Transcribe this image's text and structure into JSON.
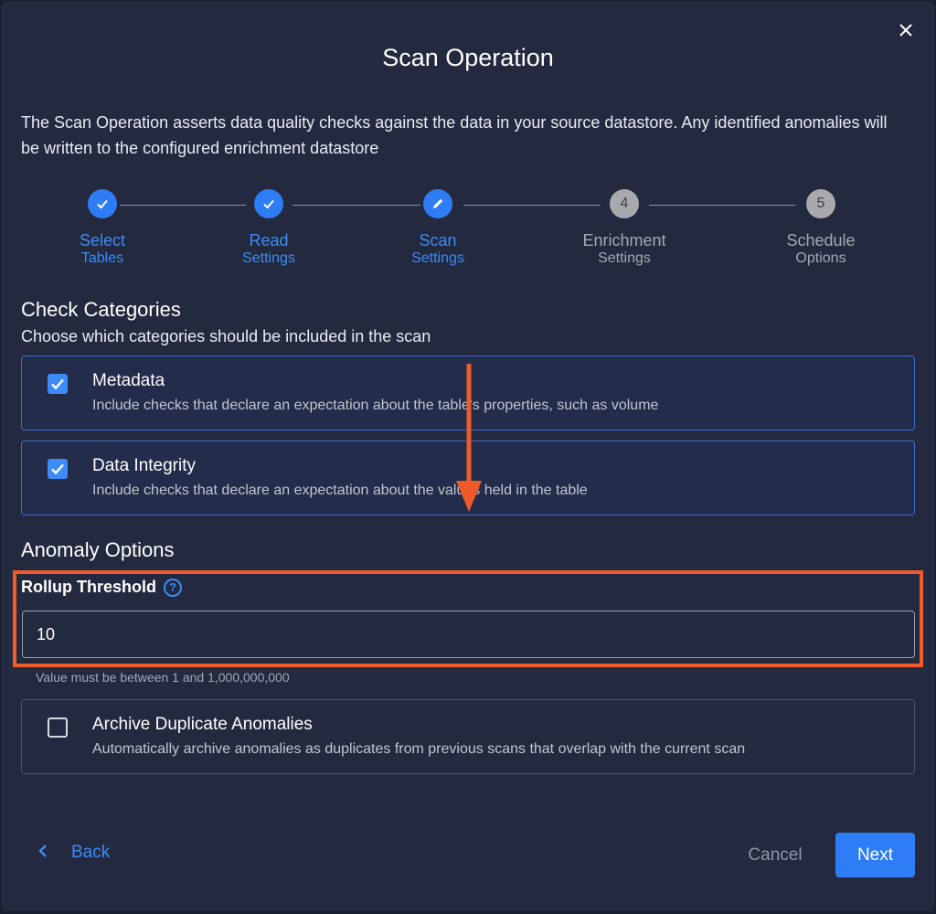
{
  "dialog": {
    "title": "Scan Operation",
    "close_icon": "close-icon",
    "description": "The Scan Operation asserts data quality checks against the data in your source datastore. Any identified anomalies will be written to the configured enrichment datastore"
  },
  "stepper": {
    "steps": [
      {
        "line1": "Select",
        "line2": "Tables",
        "state": "done",
        "icon": "check-icon"
      },
      {
        "line1": "Read",
        "line2": "Settings",
        "state": "done",
        "icon": "check-icon"
      },
      {
        "line1": "Scan",
        "line2": "Settings",
        "state": "active",
        "icon": "pencil-icon"
      },
      {
        "line1": "Enrichment",
        "line2": "Settings",
        "state": "pending",
        "number": "4"
      },
      {
        "line1": "Schedule",
        "line2": "Options",
        "state": "pending",
        "number": "5"
      }
    ]
  },
  "check_categories": {
    "title": "Check Categories",
    "subtitle": "Choose which categories should be included in the scan",
    "options": [
      {
        "title": "Metadata",
        "description": "Include checks that declare an expectation about the table's properties, such as volume",
        "checked": true
      },
      {
        "title": "Data Integrity",
        "description": "Include checks that declare an expectation about the values held in the table",
        "checked": true
      }
    ]
  },
  "anomaly_options": {
    "title": "Anomaly Options",
    "rollup_label": "Rollup Threshold",
    "rollup_help": "?",
    "rollup_value": "10",
    "rollup_hint": "Value must be between 1 and 1,000,000,000",
    "archive": {
      "title": "Archive Duplicate Anomalies",
      "description": "Automatically archive anomalies as duplicates from previous scans that overlap with the current scan",
      "checked": false
    }
  },
  "footer": {
    "back_label": "Back",
    "cancel_label": "Cancel",
    "next_label": "Next"
  },
  "colors": {
    "accent": "#2f7df6",
    "annotation": "#f05a2a",
    "background": "#232a3f"
  }
}
